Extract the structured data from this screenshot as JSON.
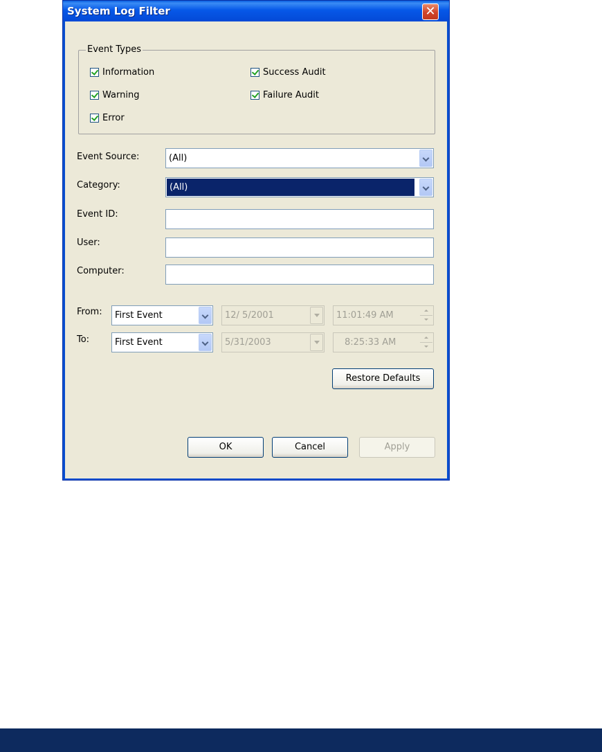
{
  "window": {
    "title": "System Log Filter",
    "close_label": "✕"
  },
  "event_types": {
    "legend": "Event Types",
    "items": [
      {
        "id": "information",
        "label": "Information",
        "checked": true
      },
      {
        "id": "success-audit",
        "label": "Success Audit",
        "checked": true
      },
      {
        "id": "warning",
        "label": "Warning",
        "checked": true
      },
      {
        "id": "failure-audit",
        "label": "Failure Audit",
        "checked": true
      },
      {
        "id": "error",
        "label": "Error",
        "checked": true
      }
    ]
  },
  "fields": {
    "event_source": {
      "label": "Event Source:",
      "value": "(All)"
    },
    "category": {
      "label": "Category:",
      "value": "(All)"
    },
    "event_id": {
      "label": "Event ID:",
      "value": ""
    },
    "user": {
      "label": "User:",
      "value": ""
    },
    "computer": {
      "label": "Computer:",
      "value": ""
    }
  },
  "range": {
    "from": {
      "label": "From:",
      "mode": "First Event",
      "date": "12/ 5/2001",
      "time": "11:01:49 AM"
    },
    "to": {
      "label": "To:",
      "mode": "First Event",
      "date": "5/31/2003",
      "time": "8:25:33 AM"
    }
  },
  "buttons": {
    "restore_defaults": "Restore Defaults",
    "ok": "OK",
    "cancel": "Cancel",
    "apply": "Apply"
  },
  "colors": {
    "titlebar": "#0a5fe0",
    "client_bg": "#ece9d8",
    "selection": "#0a246a",
    "close": "#d0432a"
  }
}
